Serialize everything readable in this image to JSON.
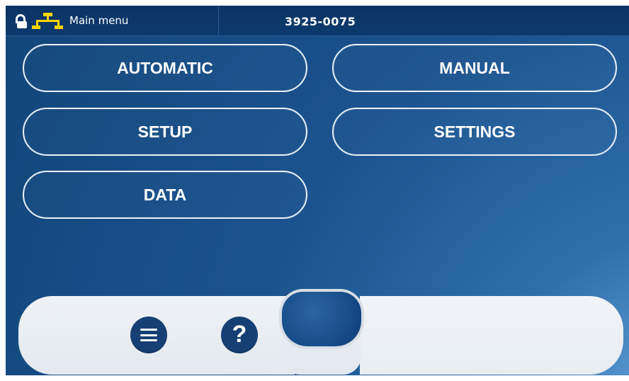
{
  "status_bar": {
    "menu_label": "Main menu",
    "machine_id": "3925-0075",
    "lock_icon": "lock-open-icon",
    "network_icon": "network-icon"
  },
  "menu": {
    "automatic": "AUTOMATIC",
    "manual": "MANUAL",
    "setup": "SETUP",
    "settings": "SETTINGS",
    "data": "DATA"
  },
  "footer": {
    "menu_icon": "hamburger-icon",
    "help_icon": "help-icon",
    "help_glyph": "?"
  },
  "colors": {
    "background_dark": "#114679",
    "background_mid": "#2f6fac",
    "status_bar": "#0c3a6d",
    "accent_yellow": "#ffd400",
    "footer_light": "#eef2f6",
    "button_dark": "#163f73"
  }
}
